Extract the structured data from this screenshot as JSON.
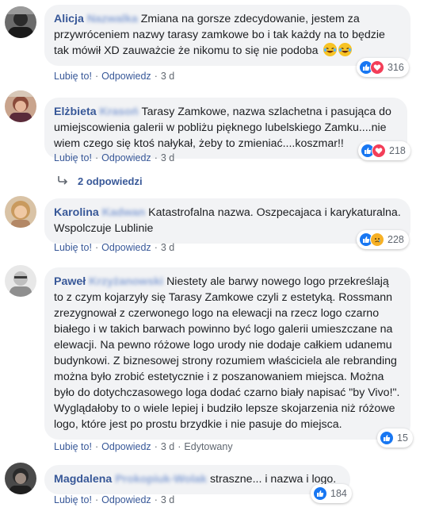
{
  "colors": {
    "link": "#385898",
    "bubble": "#f2f3f5",
    "like": "#1877f2",
    "love": "#f33e58",
    "meta": "#606770"
  },
  "actions": {
    "like": "Lubię to!",
    "reply": "Odpowiedz",
    "sep": "·"
  },
  "comments": [
    {
      "author": "Alicja",
      "surname_blurred": "Nazwalka",
      "text": "Zmiana na gorsze zdecydowanie, jestem za przywróceniem nazwy tarasy zamkowe bo i tak każdy na to będzie tak mówił XD zauważcie że nikomu to się nie podoba",
      "emoji": [
        "laughing-with-tears-icon",
        "laughing-with-tears-icon"
      ],
      "time": "3 d",
      "edited": "",
      "reactions": [
        "like-icon",
        "love-icon"
      ],
      "reaction_count": "316"
    },
    {
      "author": "Elżbieta",
      "surname_blurred": "Krasoń",
      "text": "Tarasy Zamkowe, nazwa szlachetna i pasująca do umiejscowienia galerii w pobliżu pięknego lubelskiego Zamku....nie wiem czego się ktoś nałykał, żeby to zmieniać....koszmar!!",
      "time": "3 d",
      "reactions": [
        "like-icon",
        "love-icon"
      ],
      "reaction_count": "218",
      "replies_label": "2 odpowiedzi"
    },
    {
      "author": "Karolina",
      "surname_blurred": "Kadwan",
      "text": "Katastrofalna nazwa. Oszpecajaca i karykaturalna. Wspolczuje Lublinie",
      "time": "3 d",
      "reactions": [
        "like-icon",
        "sad-icon"
      ],
      "reaction_count": "228"
    },
    {
      "author": "Paweł",
      "surname_blurred": "Krzyżanowski",
      "text": "Niestety ale barwy nowego logo przekreślają to z czym kojarzyły się Tarasy Zamkowe czyli z estetyką. Rossmann zrezygnował z czerwonego logo na elewacji na rzecz logo czarno białego i w takich barwach powinno być logo galerii umieszczane na elewacji. Na pewno różowe logo urody nie dodaje całkiem udanemu budynkowi. Z biznesowej strony rozumiem właściciela ale rebranding można było zrobić estetycznie i z poszanowaniem miejsca. Można było do dotychczasowego loga dodać czarno biały napisać \"by Vivo!\". Wyglądałoby to o wiele lepiej i budziło lepsze skojarzenia niż różowe logo, które jest po prostu brzydkie i nie pasuje do miejsca.",
      "time": "3 d",
      "edited": "Edytowany",
      "reactions": [
        "like-icon"
      ],
      "reaction_count": "15"
    },
    {
      "author": "Magdalena",
      "surname_blurred": "Prokopiuk-Wolak",
      "text": "straszne... i nazwa i logo.",
      "time": "3 d",
      "reactions": [
        "like-icon"
      ],
      "reaction_count": "184"
    }
  ]
}
